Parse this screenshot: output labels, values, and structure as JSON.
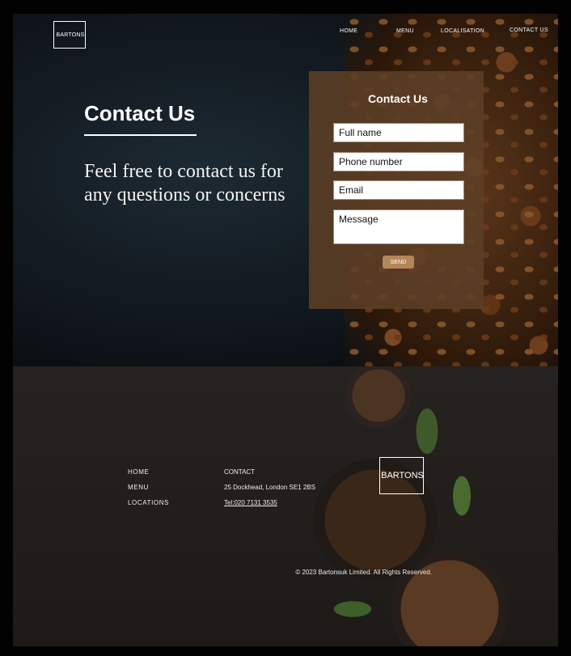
{
  "brand": {
    "logo_text": "BARTONS"
  },
  "nav": {
    "home": "HOME",
    "menu": "MENU",
    "localisation": "LOCALISATION",
    "contact": "CONTACT US"
  },
  "hero": {
    "title": "Contact Us",
    "tagline": "Feel free to contact us for any questions or concerns"
  },
  "form": {
    "title": "Contact Us",
    "full_name_placeholder": "Full name",
    "phone_placeholder": "Phone number",
    "email_placeholder": "Email",
    "message_placeholder": "Message",
    "send_label": "SEND"
  },
  "footer": {
    "nav": {
      "home": "HOME",
      "menu": "MENU",
      "locations": "LOCATIONS"
    },
    "contact": {
      "heading": "CONTACT",
      "address": "25 Dockhead, London SE1 2BS",
      "phone": "Tel:020 7131 3535"
    },
    "logo_text": "BARTONS",
    "copyright": "© 2023 Bartonsuk Limited. All Rights Reserved."
  },
  "colors": {
    "form_bg": "#5c3f26",
    "send_button": "#b58658",
    "page_bg": "#020202"
  }
}
